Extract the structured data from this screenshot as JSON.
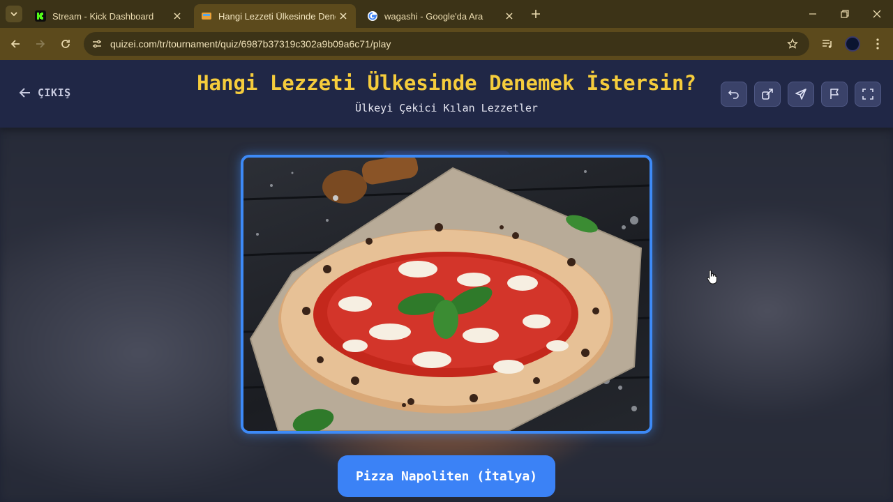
{
  "browser": {
    "tabs": [
      {
        "title": "Stream - Kick Dashboard",
        "favicon": "kick-logo-icon",
        "active": false
      },
      {
        "title": "Hangi Lezzeti Ülkesinde Denemek",
        "favicon": "quizei-icon",
        "active": true
      },
      {
        "title": "wagashi - Google'da Ara",
        "favicon": "google-icon",
        "active": false
      }
    ],
    "url": "quizei.com/tr/tournament/quiz/6987b37319c302a9b09a6c71/play"
  },
  "header": {
    "exit_label": "ÇIKIŞ",
    "title": "Hangi Lezzeti Ülkesinde Denemek İstersin?",
    "subtitle": "Ülkeyi Çekici Kılan Lezzetler",
    "actions": [
      "undo-icon",
      "share-icon",
      "send-icon",
      "flag-icon",
      "fullscreen-icon"
    ]
  },
  "choice": {
    "image_subject": "pizza-margherita-photo",
    "label": "Pizza Napoliten (İtalya)"
  },
  "colors": {
    "title_yellow": "#f5cc3c",
    "accent_blue": "#3b82f6",
    "header_bg": "#202746",
    "chrome_brown": "#5c4a1c"
  }
}
